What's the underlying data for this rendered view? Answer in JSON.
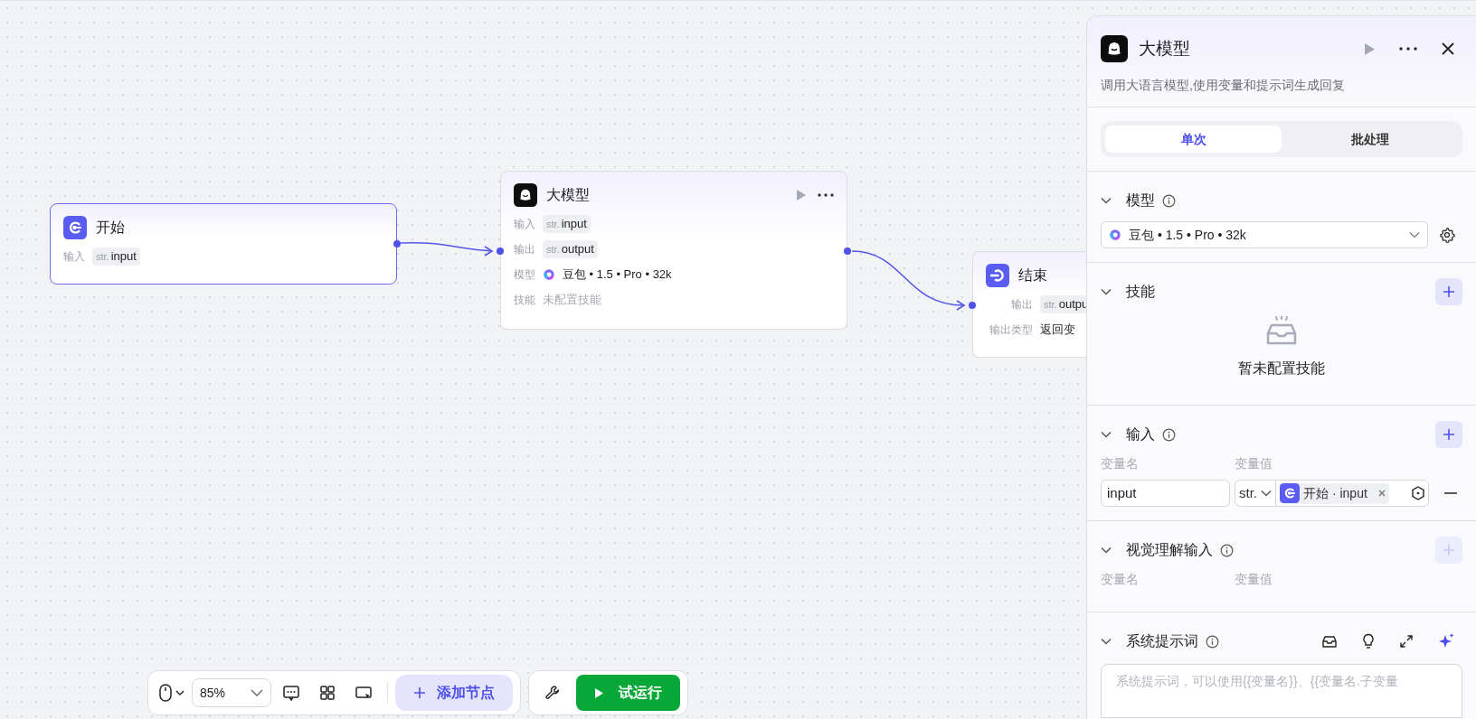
{
  "canvas": {
    "nodes": [
      {
        "kind": "start",
        "title": "开始",
        "selected": true,
        "fields": [
          {
            "kind": "var",
            "label": "输入",
            "type": "str.",
            "value": "input"
          }
        ]
      },
      {
        "kind": "llm",
        "title": "大模型",
        "selected": false,
        "fields": [
          {
            "kind": "var",
            "label": "输入",
            "type": "str.",
            "value": "input"
          },
          {
            "kind": "var",
            "label": "输出",
            "type": "str.",
            "value": "output"
          },
          {
            "kind": "model",
            "label": "模型",
            "value": "豆包 • 1.5 • Pro • 32k"
          },
          {
            "kind": "muted",
            "label": "技能",
            "value": "未配置技能"
          }
        ]
      },
      {
        "kind": "end",
        "title": "结束",
        "selected": false,
        "fields": [
          {
            "kind": "var",
            "label": "输出",
            "type": "str.",
            "value": "outpu"
          },
          {
            "kind": "plain",
            "label": "输出类型",
            "value": "返回变"
          }
        ]
      }
    ]
  },
  "toolbar": {
    "zoom": "85%",
    "add_node": "添加节点",
    "run": "试运行"
  },
  "panel": {
    "title": "大模型",
    "description": "调用大语言模型,使用变量和提示词生成回复",
    "tabs": [
      {
        "label": "单次",
        "selected": true
      },
      {
        "label": "批处理",
        "selected": false
      }
    ],
    "sections": [
      {
        "kind": "model",
        "title": "模型",
        "info": true,
        "value": "豆包 • 1.5 • Pro • 32k"
      },
      {
        "kind": "skills",
        "title": "技能",
        "info": false,
        "add_disabled": false,
        "empty": "暂未配置技能"
      },
      {
        "kind": "vars",
        "title": "输入",
        "info": true,
        "add_disabled": false,
        "columns": [
          "变量名",
          "变量值"
        ],
        "rows": [
          {
            "name": "input",
            "type": "str.",
            "ref": "开始 · input"
          }
        ]
      },
      {
        "kind": "vars",
        "title": "视觉理解输入",
        "info": true,
        "add_disabled": true,
        "columns": [
          "变量名",
          "变量值"
        ]
      },
      {
        "kind": "prompt",
        "title": "系统提示词",
        "info": true,
        "placeholder": "系统提示词，可以使用{{变量名}}、{{变量名.子变量"
      }
    ]
  }
}
